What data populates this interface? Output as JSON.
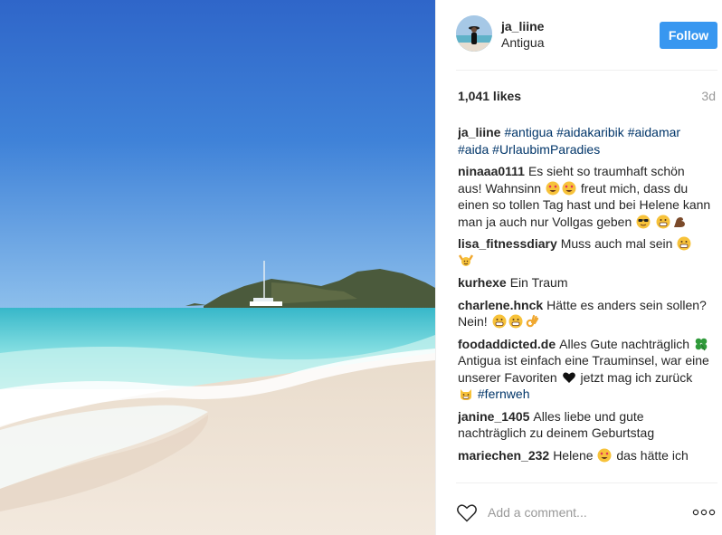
{
  "post": {
    "username": "ja_liine",
    "location": "Antigua",
    "follow_label": "Follow",
    "likes": "1,041 likes",
    "age": "3d",
    "comment_placeholder": "Add a comment...",
    "icons": {
      "heart": "heart-icon",
      "more": "more-options-icon",
      "avatar": "avatar-photo"
    },
    "colors": {
      "follow_button": "#3897f0",
      "hashtag": "#003569",
      "secondary_text": "#999999"
    }
  },
  "caption": {
    "user": "ja_liine",
    "tags": [
      "#antigua",
      "#aidakaribik",
      "#aidamar",
      "#aida",
      "#UrlaubimParadies"
    ]
  },
  "comments": [
    {
      "user": "ninaaa0111",
      "t1": "Es sieht so traumhaft schön aus! Wahnsinn",
      "t2": "freut mich, dass du einen so tollen Tag hast und bei Helene kann man ja auch nur Vollgas geben"
    },
    {
      "user": "lisa_fitnessdiary",
      "t1": "Muss auch mal sein"
    },
    {
      "user": "kurhexe",
      "t1": "Ein Traum"
    },
    {
      "user": "charlene.hnck",
      "t1": "Hätte es anders sein sollen? Nein!"
    },
    {
      "user": "foodaddicted.de",
      "t1": "Alles Gute nachträglich",
      "t2": "Antigua ist einfach eine Trauminsel, war eine unserer Favoriten",
      "t3": "jetzt mag ich zurück",
      "tag": "#fernweh"
    },
    {
      "user": "janine_1405",
      "t1": "Alles liebe und gute nachträglich zu deinem Geburtstag"
    },
    {
      "user": "mariechen_232",
      "t1": "Helene",
      "t2": "das hätte ich"
    }
  ]
}
